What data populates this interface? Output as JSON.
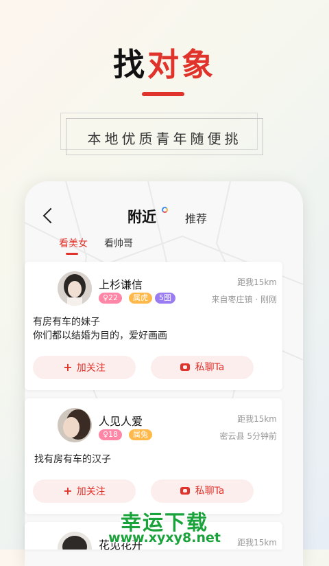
{
  "promo": {
    "title_part1": "找",
    "title_part2": "对象",
    "subtitle": "本地优质青年随便挑"
  },
  "app": {
    "tabs": {
      "nearby": "附近",
      "recommend": "推荐"
    },
    "sub_tabs": {
      "girls": "看美女",
      "guys": "看帅哥"
    },
    "profiles": [
      {
        "name": "上杉谦信",
        "distance": "距我15km",
        "location": "来自枣庄镇 · 刚刚",
        "tags": [
          "♀22",
          "属虎",
          "5图"
        ],
        "bio": [
          "有房有车的妹子",
          "你们都以结婚为目的，爱好画画"
        ],
        "follow": "加关注",
        "chat": "私聊Ta"
      },
      {
        "name": "人见人爱",
        "distance": "距我15km",
        "location": "密云县  5分钟前",
        "tags": [
          "♀18",
          "属兔"
        ],
        "bio": [
          "找有房有车的汉子"
        ],
        "follow": "加关注",
        "chat": "私聊Ta"
      },
      {
        "name": "花见花开",
        "distance": "距我15km"
      }
    ]
  },
  "watermark": {
    "title": "幸运下载",
    "url": "www.xyxy8.net"
  },
  "colors": {
    "accent": "#e0332b",
    "tag_pink": "#ff86a6",
    "tag_orange": "#ffb84a",
    "tag_purple": "#9a7cf2",
    "watermark": "#1aa33a"
  },
  "icons": {
    "back": "chevron-left-icon",
    "follow": "plus-icon",
    "chat": "chat-bubble-icon",
    "location_status": "loading-ring-icon"
  }
}
